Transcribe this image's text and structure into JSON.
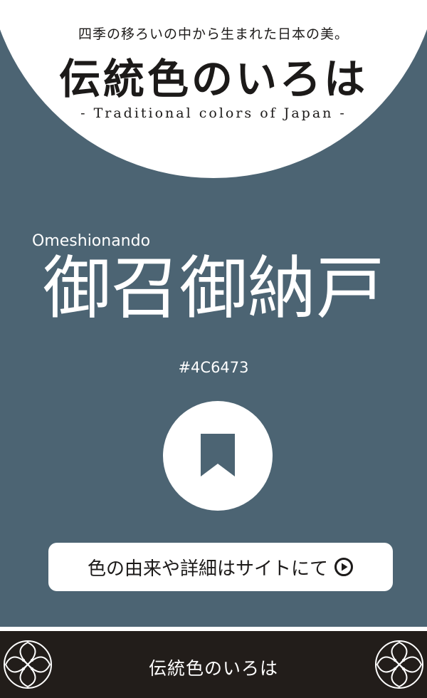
{
  "colors": {
    "background": "#4C6473",
    "header_background": "#ffffff",
    "footer_background": "#221d1a",
    "text_light": "#ffffff",
    "text_dark": "#1c1a19"
  },
  "header": {
    "tagline": "四季の移ろいの中から生まれた日本の美。",
    "logo_title": "伝統色のいろは",
    "subtitle": "- Traditional colors of Japan -"
  },
  "color": {
    "romaji": "Omeshionando",
    "kanji": "御召御納戸",
    "hex": "#4C6473"
  },
  "bookmark": {
    "icon": "bookmark-icon"
  },
  "details_link": {
    "label": "色の由来や詳細はサイトにて",
    "icon": "play-circle-icon"
  },
  "footer": {
    "title": "伝統色のいろは",
    "ornament_icon": "circle-flower-ornament-icon"
  }
}
